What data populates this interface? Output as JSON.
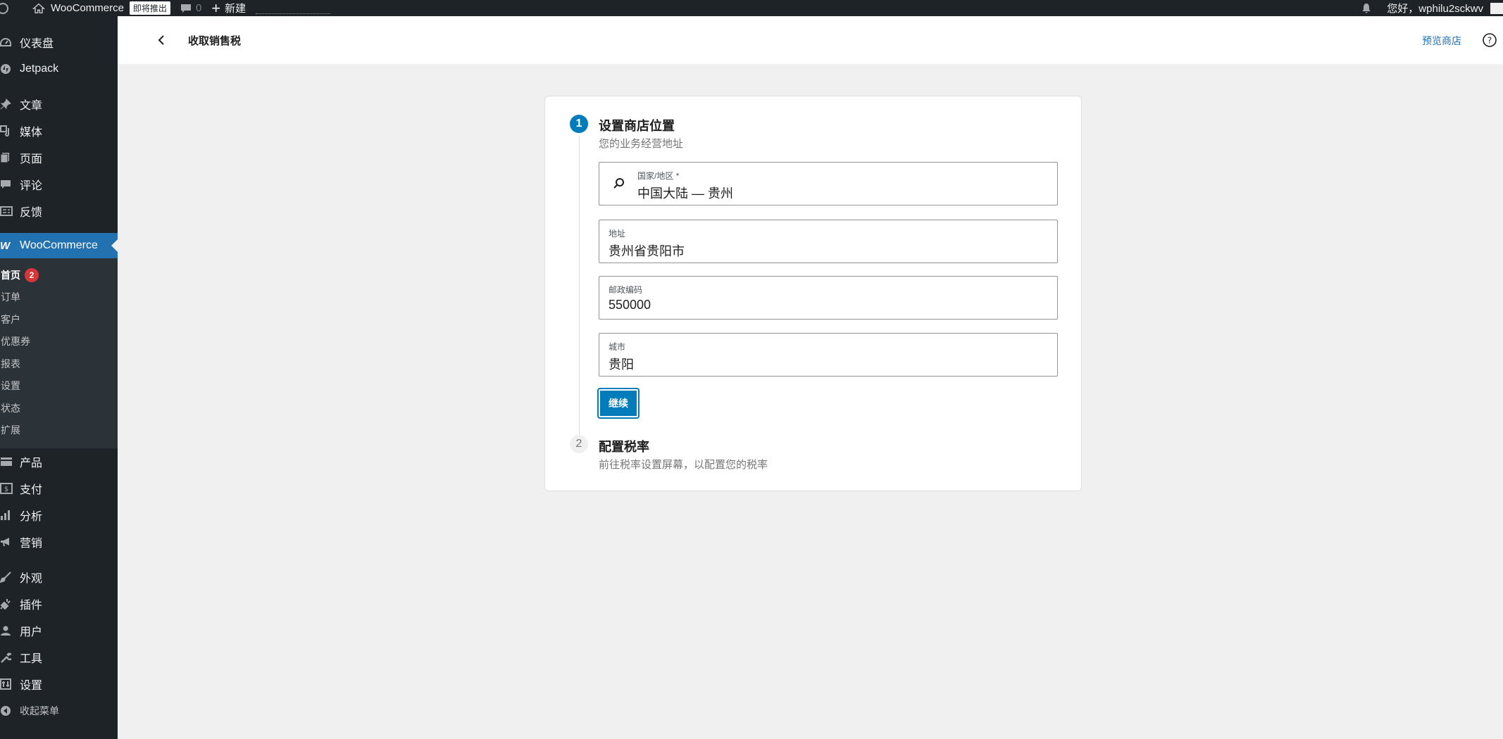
{
  "admin_bar": {
    "site_name": "WooCommerce",
    "coming_soon_badge": "即将推出",
    "comments_count": "0",
    "new_label": "新建",
    "greeting": "您好，wphilu2sckwv"
  },
  "sidebar": {
    "items_top": [
      {
        "label": "仪表盘",
        "icon": "dashboard-icon"
      },
      {
        "label": "Jetpack",
        "icon": "jetpack-icon"
      }
    ],
    "items_content": [
      {
        "label": "文章",
        "icon": "pin-icon"
      },
      {
        "label": "媒体",
        "icon": "media-icon"
      },
      {
        "label": "页面",
        "icon": "page-icon"
      },
      {
        "label": "评论",
        "icon": "comment-icon"
      },
      {
        "label": "反馈",
        "icon": "feedback-icon"
      }
    ],
    "woocommerce": {
      "label": "WooCommerce",
      "icon": "woo-icon"
    },
    "woo_submenu": [
      {
        "label": "首页",
        "badge": "2",
        "current": true
      },
      {
        "label": "订单"
      },
      {
        "label": "客户"
      },
      {
        "label": "优惠券"
      },
      {
        "label": "报表"
      },
      {
        "label": "设置"
      },
      {
        "label": "状态"
      },
      {
        "label": "扩展"
      }
    ],
    "items_store": [
      {
        "label": "产品",
        "icon": "product-icon"
      },
      {
        "label": "支付",
        "icon": "payment-icon"
      },
      {
        "label": "分析",
        "icon": "analytics-icon"
      },
      {
        "label": "营销",
        "icon": "megaphone-icon"
      }
    ],
    "items_admin": [
      {
        "label": "外观",
        "icon": "brush-icon"
      },
      {
        "label": "插件",
        "icon": "plugin-icon"
      },
      {
        "label": "用户",
        "icon": "user-icon"
      },
      {
        "label": "工具",
        "icon": "wrench-icon"
      },
      {
        "label": "设置",
        "icon": "settings-icon"
      }
    ],
    "collapse_label": "收起菜单"
  },
  "header": {
    "title": "收取销售税",
    "preview_link": "预览商店"
  },
  "steps": {
    "step1": {
      "number": "1",
      "title": "设置商店位置",
      "description": "您的业务经营地址"
    },
    "step2": {
      "number": "2",
      "title": "配置税率",
      "description": "前往税率设置屏幕，以配置您的税率"
    }
  },
  "form": {
    "country": {
      "label": "国家/地区 *",
      "value": "中国大陆 — 贵州"
    },
    "address": {
      "label": "地址",
      "value": "贵州省贵阳市"
    },
    "postcode": {
      "label": "邮政编码",
      "value": "550000"
    },
    "city": {
      "label": "城市",
      "value": "贵阳"
    },
    "continue_label": "继续"
  },
  "colors": {
    "admin_dark": "#1d2327",
    "accent_blue": "#007cba",
    "active_menu": "#2271b1",
    "badge_red": "#d63638"
  }
}
